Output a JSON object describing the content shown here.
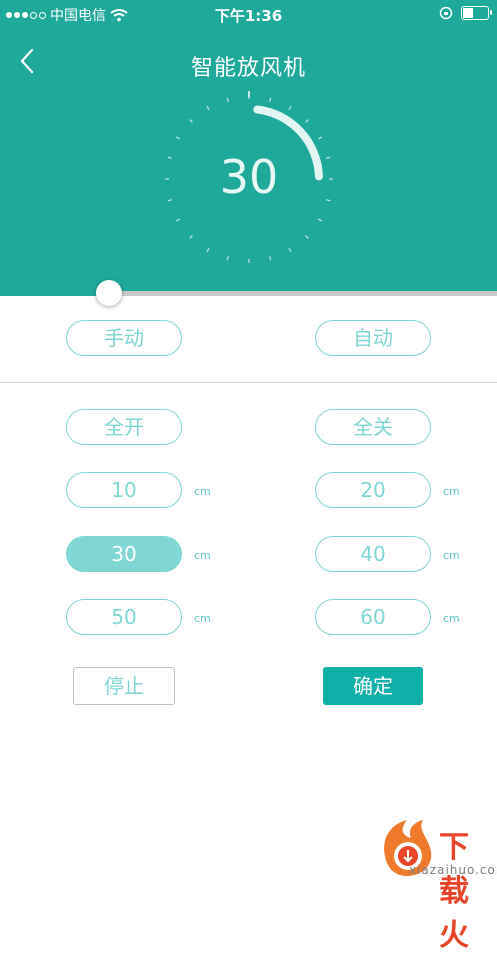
{
  "status_bar": {
    "carrier": "中国电信",
    "time": "下午1:36",
    "signal_bars_filled": 3,
    "battery_level": 0.4
  },
  "header": {
    "title": "智能放风机",
    "back_icon": "chevron-left-icon",
    "dial_value": "30",
    "dial_fill_fraction": 0.3,
    "background_color": "#1ea99b"
  },
  "position_slider": {
    "value_fraction": 0.22
  },
  "mode": {
    "manual_label": "手动",
    "auto_label": "自动"
  },
  "presets": {
    "open_all_label": "全开",
    "close_all_label": "全关",
    "unit": "cm",
    "values": [
      "10",
      "20",
      "30",
      "40",
      "50",
      "60"
    ],
    "selected": "30"
  },
  "actions": {
    "stop_label": "停止",
    "confirm_label": "确定"
  },
  "watermark": {
    "brand": "下载火",
    "url": "xiazaihuo.com"
  },
  "colors": {
    "accent": "#1ea99b",
    "pill": "#7fd6d3",
    "confirm": "#0fb0a8",
    "watermark": "#e8452b"
  }
}
